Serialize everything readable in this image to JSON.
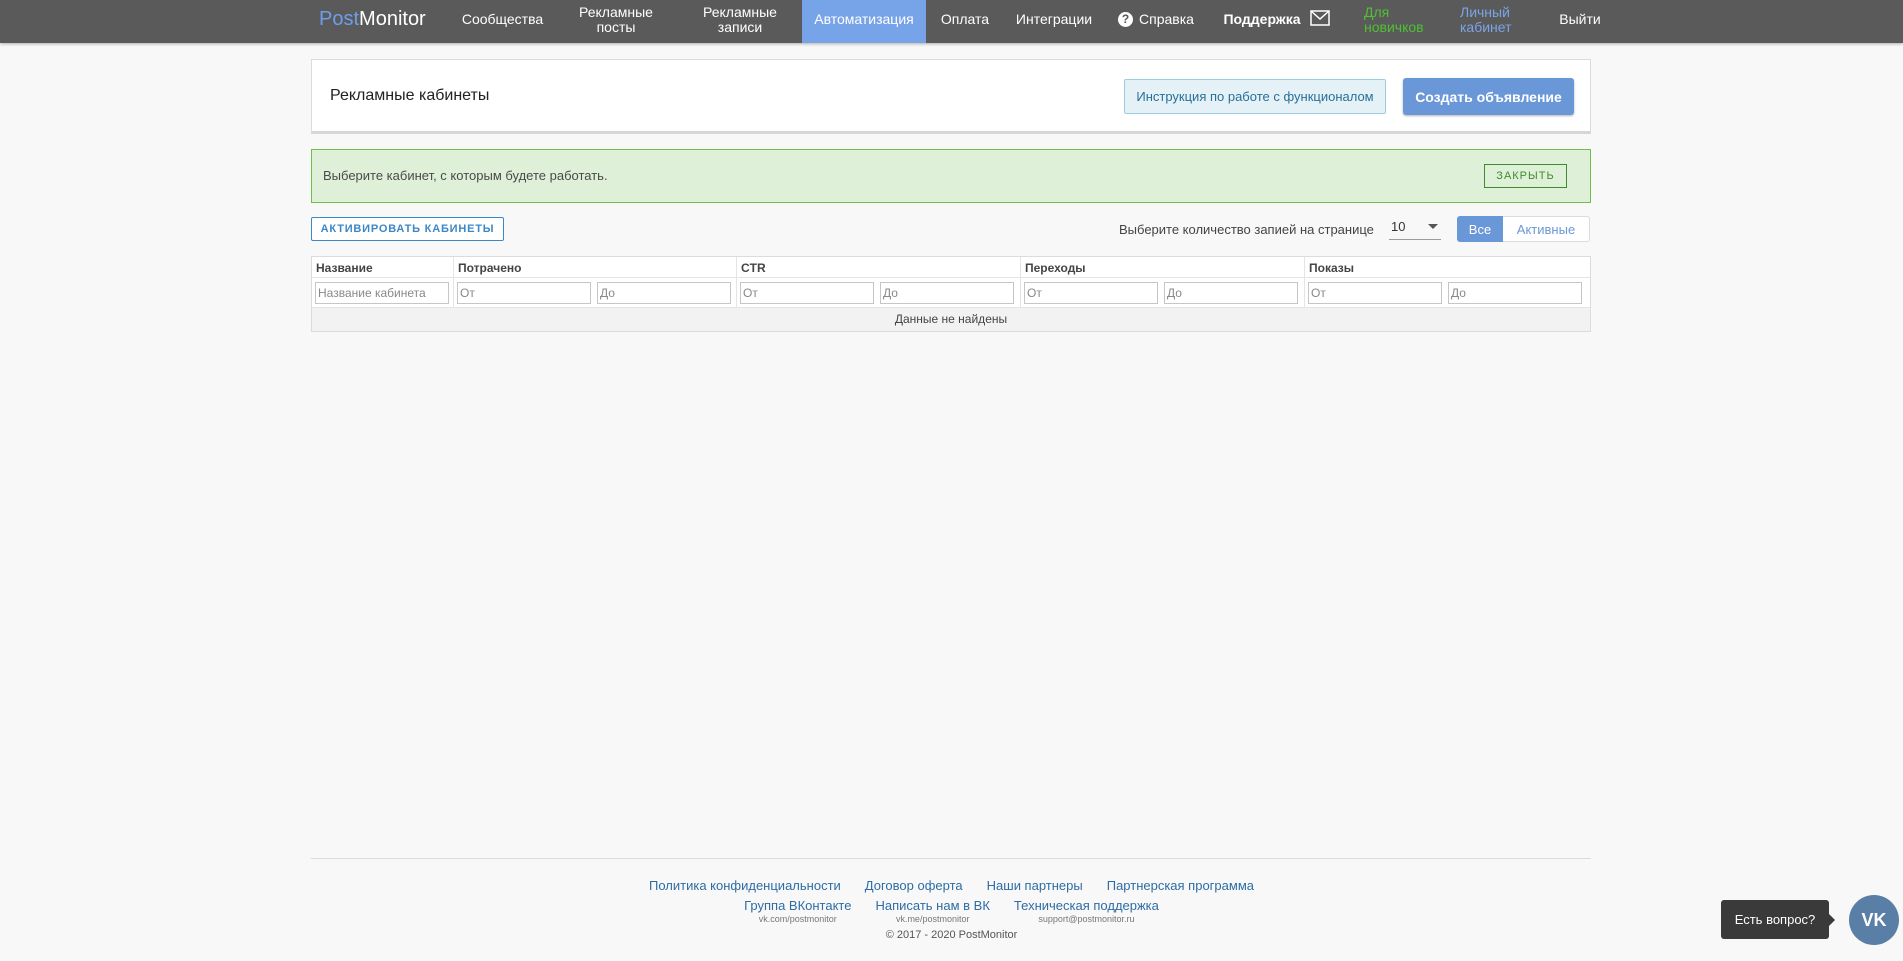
{
  "nav": {
    "logo_part1": "Post",
    "logo_part2": "Monitor",
    "items": [
      {
        "label": "Сообщества"
      },
      {
        "label": "Рекламные посты"
      },
      {
        "label": "Рекламные записи"
      },
      {
        "label": "Автоматизация"
      },
      {
        "label": "Оплата"
      },
      {
        "label": "Интеграции"
      },
      {
        "label": "Справка"
      },
      {
        "label": "Поддержка"
      },
      {
        "label": "Для новичков"
      },
      {
        "label": "Личный кабинет"
      },
      {
        "label": "Выйти"
      }
    ],
    "help_glyph": "?"
  },
  "header": {
    "title": "Рекламные кабинеты",
    "instruction_label": "Инструкция по работе с функционалом",
    "create_label": "Создать объявление"
  },
  "alert": {
    "text": "Выберите кабинет, с которым будете работать.",
    "close_label": "ЗАКРЫТЬ"
  },
  "controls": {
    "activate_label": "АКТИВИРОВАТЬ КАБИНЕТЫ",
    "per_page_label": "Выберите количество запией на странице",
    "per_page_value": "10",
    "filter_all": "Все",
    "filter_active": "Активные"
  },
  "table": {
    "columns": [
      "Название",
      "Потрачено",
      "CTR",
      "Переходы",
      "Показы"
    ],
    "name_placeholder": "Название кабинета",
    "from_placeholder": "От",
    "to_placeholder": "До",
    "empty_text": "Данные не найдены"
  },
  "footer": {
    "row1": [
      "Политика конфиденциальности",
      "Договор оферта",
      "Наши партнеры",
      "Партнерская программа"
    ],
    "row2": [
      {
        "label": "Группа ВКонтакте",
        "sub": "vk.com/postmonitor"
      },
      {
        "label": "Написать нам в ВК",
        "sub": "vk.me/postmonitor"
      },
      {
        "label": "Техническая поддержка",
        "sub": "support@postmonitor.ru"
      }
    ],
    "copyright": "© 2017 - 2020 PostMonitor"
  },
  "chat": {
    "bubble": "Есть вопрос?",
    "vk_label": "VK"
  },
  "colors": {
    "nav_bg": "#5a5a5a",
    "accent": "#6a97d8",
    "active_nav": "#77a3e8",
    "alert_bg": "#dff0d8",
    "green": "#4fc132"
  }
}
